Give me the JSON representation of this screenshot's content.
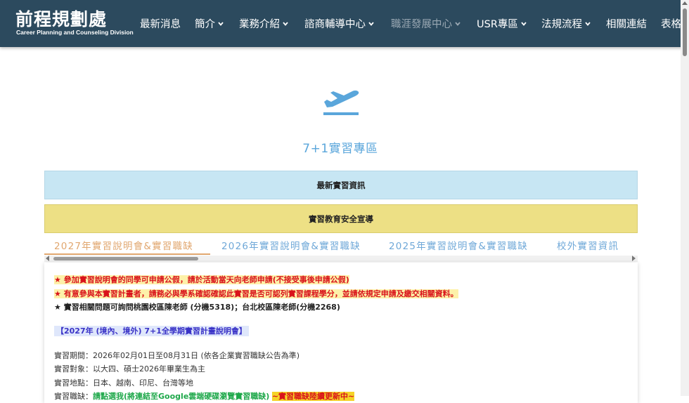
{
  "header": {
    "title": "前程規劃處",
    "subtitle": "Career Planning and Counseling Division",
    "nav": [
      {
        "label": "最新消息",
        "has_dropdown": false
      },
      {
        "label": "簡介",
        "has_dropdown": true
      },
      {
        "label": "業務介紹",
        "has_dropdown": true
      },
      {
        "label": "諮商輔導中心",
        "has_dropdown": true
      },
      {
        "label": "職涯發展中心",
        "has_dropdown": true,
        "dimmed": true
      },
      {
        "label": "USR專區",
        "has_dropdown": true
      },
      {
        "label": "法規流程",
        "has_dropdown": true
      },
      {
        "label": "相關連結",
        "has_dropdown": false
      },
      {
        "label": "表格",
        "has_dropdown": false
      }
    ]
  },
  "hero": {
    "icon": "airplane-takeoff-icon",
    "title": "7+1實習專區"
  },
  "banners": {
    "latest": "最新實習資訊",
    "safety": "實習教育安全宣導"
  },
  "tabs": [
    {
      "label": "2027年實習說明會&實習職缺",
      "active": true
    },
    {
      "label": "2026年實習說明會&實習職缺",
      "active": false
    },
    {
      "label": "2025年實習說明會&實習職缺",
      "active": false
    },
    {
      "label": "校外實習資訊",
      "active": false
    }
  ],
  "content": {
    "notice1": "★ 參加實習說明會的同學可申請公假，請於活動當天向老師申請(不接受事後申請公假)",
    "notice2": "★ 有意參與本實習計畫者，請務必與學系確認確認此實習是否可認列實習課程學分，並請依規定申請及繳交相關資料。",
    "notice3": "★ 實習相關問題可詢問桃園校區陳老師 (分機5318)；台北校區陳老師(分機2268)",
    "section_title": "【2027年 (境內、境外) 7+1全學期實習計畫說明會】",
    "period": "實習期間：2026年02月01日至08月31日 (依各企業實習職缺公告為準)",
    "target": "實習對象：以大四、碩士2026年畢業生為主",
    "location": "實習地點：日本、越南、印尼、台灣等地",
    "jobs_label": "實習職缺：",
    "jobs_link": "請點選我(將連結至Google雲端硬碟瀏覽實習職缺)",
    "jobs_update": "~實習職缺陸續更新中~"
  },
  "colors": {
    "header_bg": "#2c4a5e",
    "accent_blue": "#5aa6db",
    "tab_active": "#e1a76f",
    "banner_blue": "#c7e6f3",
    "banner_yellow": "#ede085",
    "notice_red": "#d9131b"
  }
}
